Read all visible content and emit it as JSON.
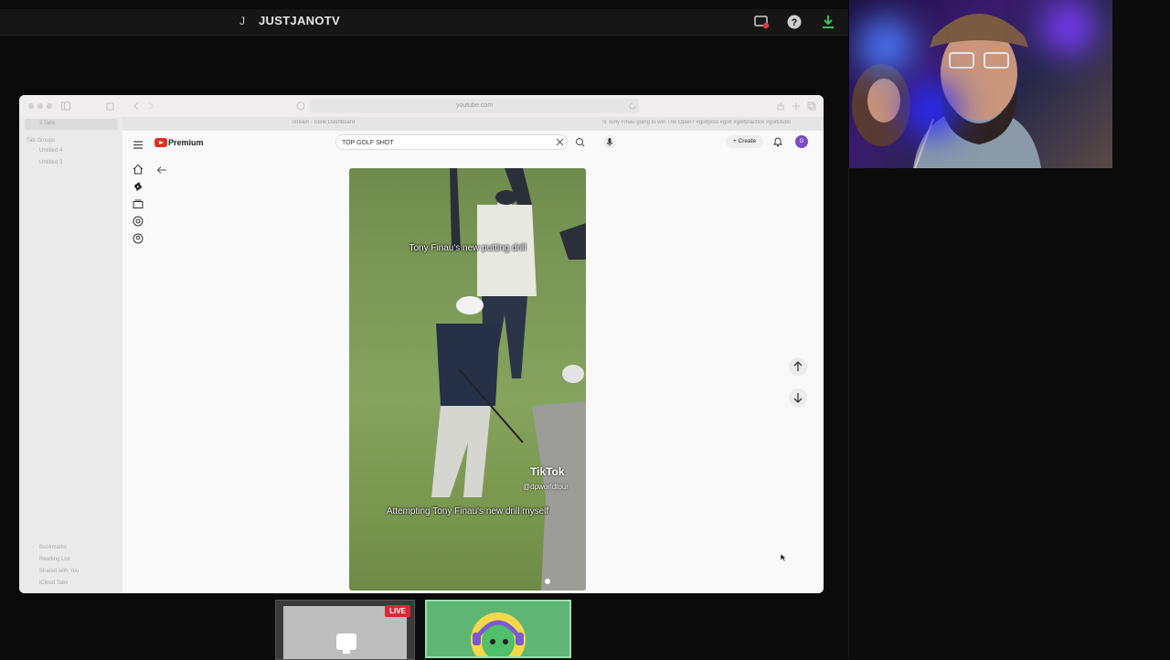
{
  "topbar": {
    "avatar_letter": "J",
    "channel_name": "JUSTJANOTV",
    "icons": [
      "screen-share-icon",
      "help-icon",
      "download-icon"
    ]
  },
  "browser": {
    "url": "youtube.com",
    "tabs": [
      {
        "label": "Stream - Stink Dashboard"
      },
      {
        "label": "Is Tony Finau going to win The Open? #golfpost #golf #golfpractice #golfclubs"
      }
    ],
    "sidebar": {
      "tab_group": "2 Tabs",
      "section": "Tab Groups",
      "groups": [
        "Untitled 4",
        "Untitled 3"
      ],
      "bottom_items": [
        "Bookmarks",
        "Reading List",
        "Shared with You",
        "iCloud Tabs"
      ]
    }
  },
  "youtube": {
    "logo_text": "Premium",
    "search_value": "TOP GOLF  SHOT",
    "create_label": "Create",
    "account_initial": "G",
    "video": {
      "caption_top": "Tony Finau's new putting drill",
      "caption_bottom": "Attempting Tony Finau's new drill myself",
      "watermark": "TikTok",
      "watermark_user": "@dpworldtour"
    }
  },
  "overlay": {
    "live_badge": "LIVE"
  },
  "colors": {
    "accent_red": "#e52d27",
    "live_red": "#d62b35",
    "avatar_purple": "#7c4bc1",
    "field_green": "#7d9a58"
  }
}
